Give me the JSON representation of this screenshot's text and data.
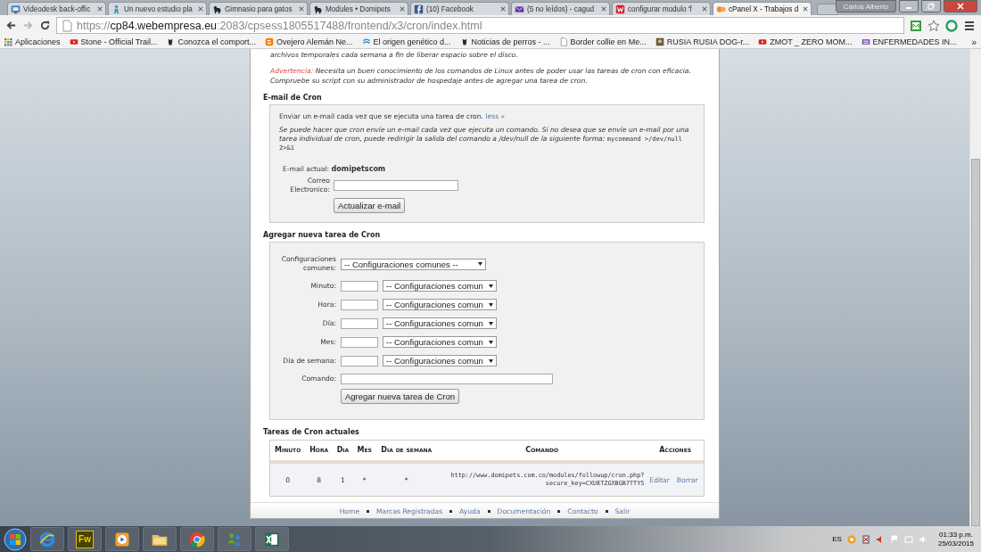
{
  "browser": {
    "tabs": [
      {
        "title": "Videodesk back-offic",
        "selected": false
      },
      {
        "title": "Un nuevo estudio pla",
        "selected": false
      },
      {
        "title": "Gimnasio para gatos",
        "selected": false
      },
      {
        "title": "Modules • Domipets",
        "selected": false
      },
      {
        "title": "(10) Facebook",
        "selected": false
      },
      {
        "title": "(5 no leídos) - cagud",
        "selected": false
      },
      {
        "title": "configurar modulo 'f",
        "selected": false
      },
      {
        "title": "cPanel X - Trabajos d",
        "selected": true
      }
    ],
    "profile": "Carlos Alberto",
    "address": {
      "scheme": "https://",
      "host": "cp84.webempresa.eu",
      "path": ":2083/cpsess1805517488/frontend/x3/cron/index.html"
    },
    "apps_label": "Aplicaciones",
    "bookmarks": [
      {
        "label": "Stone - Official Trail..."
      },
      {
        "label": "Conozca el comport..."
      },
      {
        "label": "Ovejero Alemán Ne..."
      },
      {
        "label": "El origen genético d..."
      },
      {
        "label": "Noticias de perros - ..."
      },
      {
        "label": "Border collie en Me..."
      },
      {
        "label": "RUSIA RUSIA DOG-r..."
      },
      {
        "label": "ZMOT _ ZERO MOM..."
      },
      {
        "label": "ENFERMEDADES IN..."
      }
    ],
    "more": "»"
  },
  "page": {
    "intro_tail": "archivos temporales cada semana a fin de liberar espacio sobre el disco.",
    "warning": {
      "label": "Advertencia:",
      "text": "Necesita un buen conocimiento de los comandos de Linux antes de poder usar las tareas de cron con eficacia. Compruebe su script con su administrador de hospedaje antes de agregar una tarea de cron."
    },
    "email": {
      "heading": "E-mail de Cron",
      "description": "Enviar un e-mail cada vez que se ejecuta una tarea de cron.",
      "toggle": "less »",
      "explanation": "Se puede hacer que cron envíe un e-mail cada vez que ejecuta un comando. Si no desea que se envíe un e-mail por una tarea individual de cron, puede redirigir la salida del comando a /dev/null de la siguiente forma:",
      "explanation_code": "mycommand >/dev/null 2>&1",
      "current_label": "E-mail actual:",
      "current_value": "domipetscom",
      "field_label": "Correo Electronico:",
      "button": "Actualizar e-mail"
    },
    "add": {
      "heading": "Agregar nueva tarea de Cron",
      "common_label": "Configuraciones comunes:",
      "common_select": "-- Configuraciones comunes --",
      "rows": [
        {
          "label": "Minuto:",
          "select": "-- Configuraciones comun"
        },
        {
          "label": "Hora:",
          "select": "-- Configuraciones comun"
        },
        {
          "label": "Día:",
          "select": "-- Configuraciones comun"
        },
        {
          "label": "Mes:",
          "select": "-- Configuraciones comun"
        },
        {
          "label": "Día de semana:",
          "select": "-- Configuraciones comun"
        }
      ],
      "command_label": "Comando:",
      "button": "Agregar nueva tarea de Cron"
    },
    "current": {
      "heading": "Tareas de Cron actuales",
      "columns": [
        "Minuto",
        "Hora",
        "Dia",
        "Mes",
        "Dia de semana",
        "Comando",
        "Acciones"
      ],
      "rows": [
        {
          "cells": [
            "0",
            "8",
            "1",
            "*",
            "*"
          ],
          "command_lines": [
            "http://www.domipets.com.co/modules/followup/cron.php?",
            "secure_key=CXUETZGXBGB7TTY5"
          ],
          "actions": [
            "Editar",
            "Borrar"
          ]
        }
      ]
    },
    "footer": [
      "Home",
      "Marcas Registradas",
      "Ayuda",
      "Documentación",
      "Contacto",
      "Salir"
    ]
  },
  "taskbar": {
    "apps": [
      {
        "kind": "browser-e"
      },
      {
        "kind": "fw",
        "label": "Fw"
      },
      {
        "kind": "media"
      },
      {
        "kind": "folder"
      },
      {
        "kind": "chrome"
      },
      {
        "kind": "people"
      },
      {
        "kind": "sheet"
      }
    ],
    "language": "ES",
    "time": "01:33 p.m.",
    "date": "25/03/2015"
  }
}
